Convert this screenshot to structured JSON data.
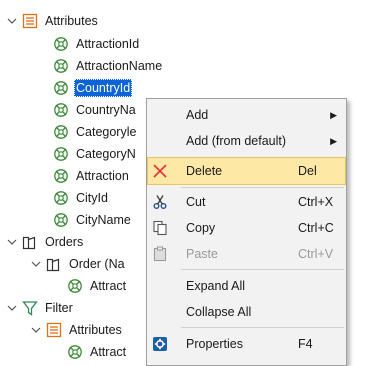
{
  "tree": {
    "attributes_label": "Attributes",
    "attribute_items": [
      "AttractionId",
      "AttractionName",
      "CountryId",
      "CountryNa",
      "Categoryle",
      "CategoryN",
      "Attraction",
      "CityId",
      "CityName"
    ],
    "orders_label": "Orders",
    "order_label": "Order (Na",
    "order_child_label": "Attract",
    "filter_label": "Filter",
    "filter_attributes_label": "Attributes",
    "filter_child_label": "Attract"
  },
  "context_menu": {
    "add": "Add",
    "add_from_default": "Add (from default)",
    "delete": "Delete",
    "delete_shortcut": "Del",
    "cut": "Cut",
    "cut_shortcut": "Ctrl+X",
    "copy": "Copy",
    "copy_shortcut": "Ctrl+C",
    "paste": "Paste",
    "paste_shortcut": "Ctrl+V",
    "expand_all": "Expand All",
    "collapse_all": "Collapse All",
    "properties": "Properties",
    "properties_shortcut": "F4"
  },
  "colors": {
    "selection": "#0b63d8",
    "highlight": "#fde8a6",
    "attribute_icon": "#3e8a3b",
    "folder_icon": "#e0701a",
    "delete_icon": "#e03a3a"
  }
}
